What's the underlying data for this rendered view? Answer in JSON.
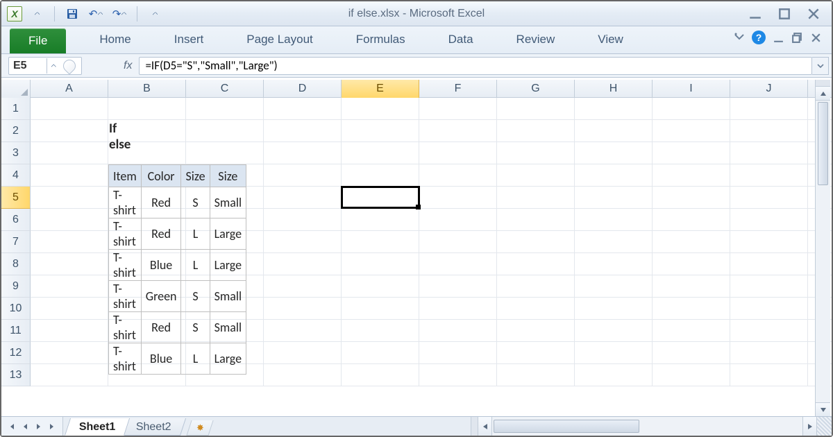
{
  "title": "if else.xlsx - Microsoft Excel",
  "ribbon": {
    "file": "File",
    "tabs": [
      "Home",
      "Insert",
      "Page Layout",
      "Formulas",
      "Data",
      "Review",
      "View"
    ]
  },
  "fbar": {
    "name_box": "E5",
    "fx_label": "fx",
    "formula": "=IF(D5=\"S\",\"Small\",\"Large\")"
  },
  "columns": [
    "A",
    "B",
    "C",
    "D",
    "E",
    "F",
    "G",
    "H",
    "I",
    "J"
  ],
  "selected_column": "E",
  "selected_row": 5,
  "active_cell_label": "E5",
  "section_title": "If else",
  "table": {
    "headers": [
      "Item",
      "Color",
      "Size",
      "Size"
    ],
    "rows": [
      [
        "T-shirt",
        "Red",
        "S",
        "Small"
      ],
      [
        "T-shirt",
        "Red",
        "L",
        "Large"
      ],
      [
        "T-shirt",
        "Blue",
        "L",
        "Large"
      ],
      [
        "T-shirt",
        "Green",
        "S",
        "Small"
      ],
      [
        "T-shirt",
        "Red",
        "S",
        "Small"
      ],
      [
        "T-shirt",
        "Blue",
        "L",
        "Large"
      ]
    ]
  },
  "sheets": {
    "active": "Sheet1",
    "others": [
      "Sheet2"
    ]
  },
  "row_count_visible": 13
}
